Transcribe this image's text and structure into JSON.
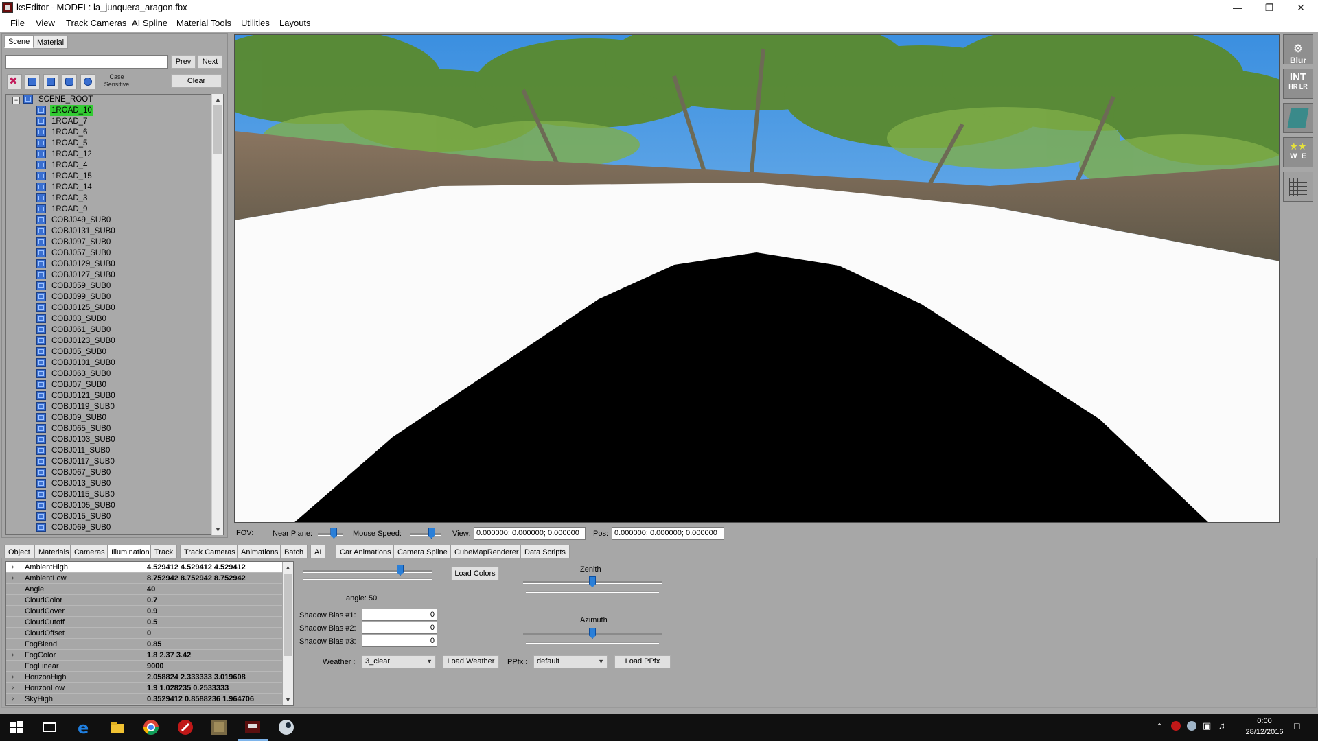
{
  "window": {
    "title": "ksEditor - MODEL: la_junquera_aragon.fbx",
    "controls": [
      "minimize",
      "restore",
      "close"
    ]
  },
  "menu": [
    "File",
    "View",
    "Track Cameras",
    "AI Spline",
    "Material Tools",
    "Utilities",
    "Layouts"
  ],
  "left_panel": {
    "tabs": [
      "Scene",
      "Material"
    ],
    "active_tab": "Scene",
    "search": {
      "value": "",
      "placeholder": ""
    },
    "prev_label": "Prev",
    "next_label": "Next",
    "clear_label": "Clear",
    "case_sensitive_label": "Case Sensitive",
    "filter_icons": [
      "clear-filter-icon",
      "mesh-filter-icon",
      "node-filter-icon",
      "material-filter-icon",
      "texture-filter-icon"
    ],
    "tree": {
      "root": "SCENE_ROOT",
      "selected": "1ROAD_10",
      "items": [
        "1ROAD_10",
        "1ROAD_7",
        "1ROAD_6",
        "1ROAD_5",
        "1ROAD_12",
        "1ROAD_4",
        "1ROAD_15",
        "1ROAD_14",
        "1ROAD_3",
        "1ROAD_9",
        "COBJ049_SUB0",
        "COBJ0131_SUB0",
        "COBJ097_SUB0",
        "COBJ057_SUB0",
        "COBJ0129_SUB0",
        "COBJ0127_SUB0",
        "COBJ059_SUB0",
        "COBJ099_SUB0",
        "COBJ0125_SUB0",
        "COBJ03_SUB0",
        "COBJ061_SUB0",
        "COBJ0123_SUB0",
        "COBJ05_SUB0",
        "COBJ0101_SUB0",
        "COBJ063_SUB0",
        "COBJ07_SUB0",
        "COBJ0121_SUB0",
        "COBJ0119_SUB0",
        "COBJ09_SUB0",
        "COBJ065_SUB0",
        "COBJ0103_SUB0",
        "COBJ011_SUB0",
        "COBJ0117_SUB0",
        "COBJ067_SUB0",
        "COBJ013_SUB0",
        "COBJ0115_SUB0",
        "COBJ0105_SUB0",
        "COBJ015_SUB0",
        "COBJ069_SUB0"
      ]
    }
  },
  "right_tools": {
    "blur": "Blur",
    "int": "INT",
    "hr": "HR",
    "lr": "LR",
    "w": "W",
    "e": "E"
  },
  "viewport_controls": {
    "fov_label": "FOV:",
    "near_plane_label": "Near Plane:",
    "mouse_speed_label": "Mouse Speed:",
    "view_label": "View:",
    "view_value": "0.000000; 0.000000; 0.000000",
    "pos_label": "Pos:",
    "pos_value": "0.000000; 0.000000; 0.000000",
    "near_plane_level": 0.65,
    "mouse_speed_level": 0.7
  },
  "bottom_tabs": [
    "Object",
    "Materials",
    "Cameras",
    "Illumination",
    "Track",
    "Track Cameras",
    "Animations",
    "Batch",
    "AI",
    "Car Animations",
    "Camera Spline",
    "CubeMapRenderer",
    "Data Scripts"
  ],
  "active_bottom_tab": "Illumination",
  "properties": [
    {
      "name": "AmbientHigh",
      "value": "4.529412 4.529412 4.529412",
      "expandable": true
    },
    {
      "name": "AmbientLow",
      "value": "8.752942 8.752942 8.752942",
      "expandable": true
    },
    {
      "name": "Angle",
      "value": "40",
      "expandable": false
    },
    {
      "name": "CloudColor",
      "value": "0.7",
      "expandable": false
    },
    {
      "name": "CloudCover",
      "value": "0.9",
      "expandable": false
    },
    {
      "name": "CloudCutoff",
      "value": "0.5",
      "expandable": false
    },
    {
      "name": "CloudOffset",
      "value": "0",
      "expandable": false
    },
    {
      "name": "FogBlend",
      "value": "0.85",
      "expandable": false
    },
    {
      "name": "FogColor",
      "value": "1.8 2.37 3.42",
      "expandable": true
    },
    {
      "name": "FogLinear",
      "value": "9000",
      "expandable": false
    },
    {
      "name": "HorizonHigh",
      "value": "2.058824 2.333333 3.019608",
      "expandable": true
    },
    {
      "name": "HorizonLow",
      "value": "1.9 1.028235 0.2533333",
      "expandable": true
    },
    {
      "name": "SkyHigh",
      "value": "0.3529412 0.8588236 1.964706",
      "expandable": true
    }
  ],
  "illumination": {
    "angle_text": "angle: 50",
    "angle_level": 0.75,
    "load_colors_label": "Load Colors",
    "zenith_label": "Zenith",
    "zenith_level": 0.5,
    "azimuth_label": "Azimuth",
    "azimuth_level": 0.5,
    "shadow_bias": [
      {
        "label": "Shadow Bias #1:",
        "value": "0"
      },
      {
        "label": "Shadow Bias #2:",
        "value": "0"
      },
      {
        "label": "Shadow Bias #3:",
        "value": "0"
      }
    ],
    "weather_label": "Weather :",
    "weather_value": "3_clear",
    "load_weather_label": "Load Weather",
    "ppfx_label": "PPfx :",
    "ppfx_value": "default",
    "load_ppfx_label": "Load PPfx"
  },
  "taskbar": {
    "time": "0:00",
    "date": "28/12/2016",
    "apps": [
      "windows-start-icon",
      "task-view-icon",
      "edge-icon",
      "file-explorer-icon",
      "chrome-icon",
      "acrobat-icon",
      "game-app-icon",
      "kseditor-icon",
      "steam-app-icon"
    ]
  },
  "colors": {
    "selection_green": "#33cc33",
    "panel_gray": "#a7a7a7",
    "accent_blue": "#2a7fd8",
    "taskbar": "#101010"
  }
}
